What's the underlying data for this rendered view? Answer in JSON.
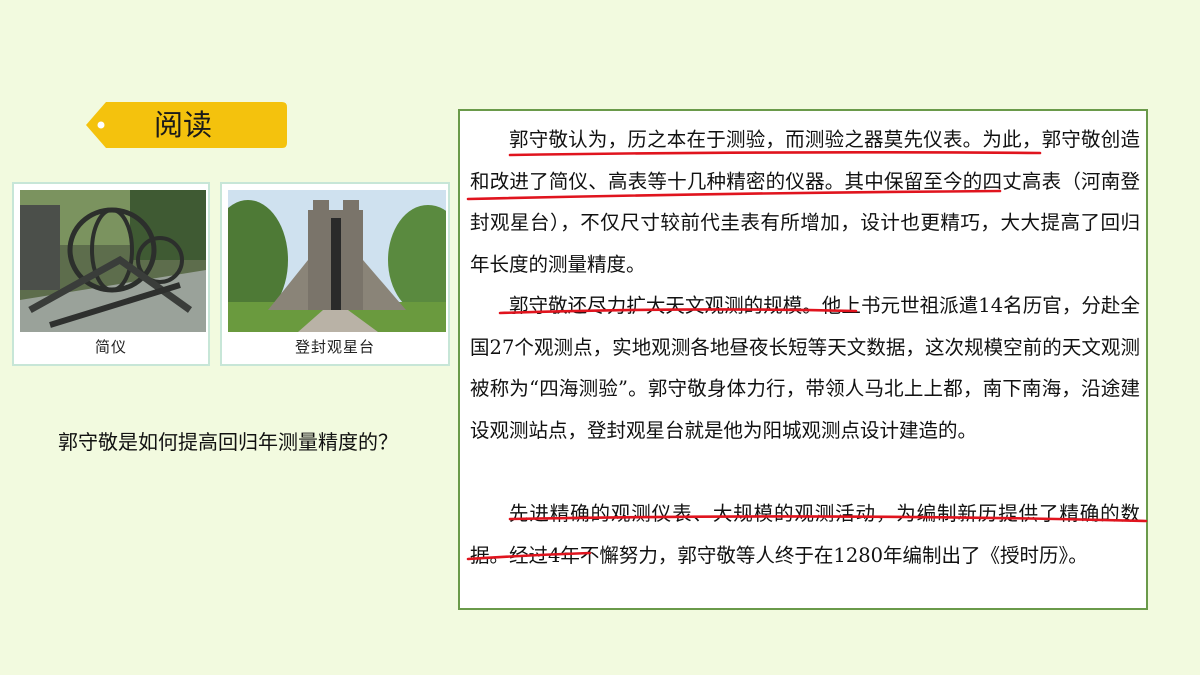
{
  "tag": {
    "label": "阅读"
  },
  "photos": [
    {
      "caption": "简仪"
    },
    {
      "caption": "登封观星台"
    }
  ],
  "question": "郭守敬是如何提高回归年测量精度的？",
  "paragraphs": [
    "郭守敬认为，历之本在于测验，而测验之器莫先仪表。为此，郭守敬创造和改进了简仪、高表等十几种精密的仪器。其中保留至今的四丈高表（河南登封观星台），不仅尺寸较前代圭表有所增加，设计也更精巧，大大提高了回归年长度的测量精度。",
    "郭守敬还尽力扩大天文观测的规模。他上书元世祖派遣14名历官，分赴全国27个观测点，实地观测各地昼夜长短等天文数据，这次规模空前的天文观测被称为“四海测验”。郭守敬身体力行，带领人马北上上都，南下南海，沿途建设观测站点，登封观星台就是他为阳城观测点设计建造的。",
    "先进精确的观测仪表、大规模的观测活动，为编制新历提供了精确的数据。经过4年不懈努力，郭守敬等人终于在1280年编制出了《授时历》。"
  ],
  "colors": {
    "underline": "#e0141e",
    "tag_fill": "#f4c20d",
    "border": "#6a9a4a"
  }
}
